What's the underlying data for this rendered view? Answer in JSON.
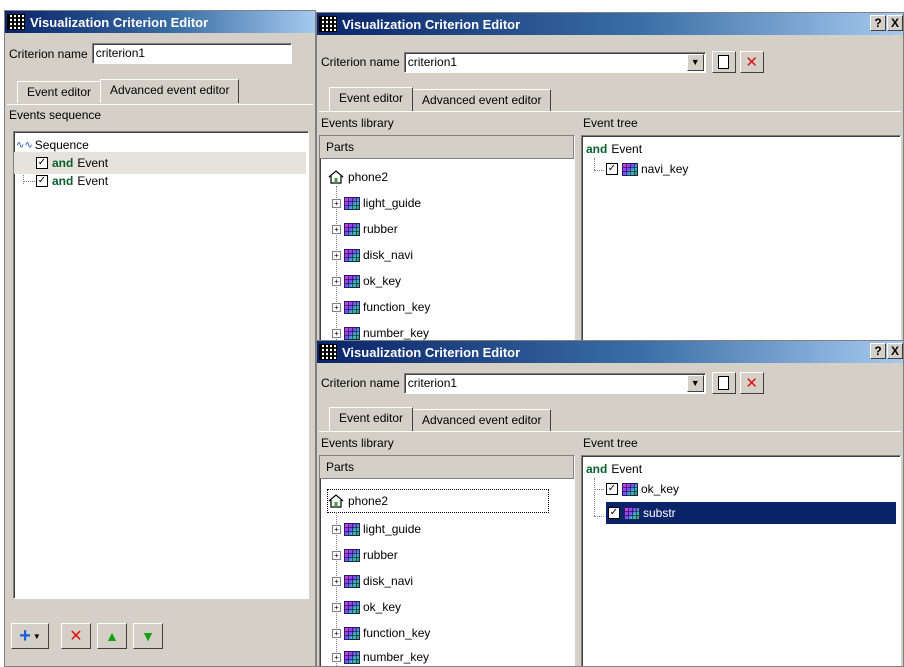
{
  "left_window": {
    "title": "Visualization Criterion Editor",
    "criterion_label": "Criterion name",
    "criterion_value": "criterion1",
    "tabs": [
      {
        "label": "Event editor",
        "active": false
      },
      {
        "label": "Advanced event editor",
        "active": true
      }
    ],
    "section_title": "Events sequence",
    "sequence_label": "Sequence",
    "events": [
      {
        "keyword": "and",
        "label": "Event",
        "checked": true
      },
      {
        "keyword": "and",
        "label": "Event",
        "checked": true
      }
    ],
    "toolbar": {
      "add_icon": "add-dropdown-icon",
      "delete_icon": "delete-icon",
      "up_icon": "move-up-icon",
      "down_icon": "move-down-icon"
    }
  },
  "top_window": {
    "title": "Visualization Criterion Editor",
    "help_label": "?",
    "close_label": "X",
    "criterion_label": "Criterion name",
    "criterion_value": "criterion1",
    "tabs": [
      {
        "label": "Event editor",
        "active": true
      },
      {
        "label": "Advanced event editor",
        "active": false
      }
    ],
    "events_library_label": "Events library",
    "event_tree_label": "Event tree",
    "parts_header": "Parts",
    "root": "phone2",
    "parts": [
      "light_guide",
      "rubber",
      "disk_navi",
      "ok_key",
      "function_key",
      "number_key"
    ],
    "tree_root": {
      "keyword": "and",
      "label": "Event"
    },
    "tree_children": [
      {
        "label": "navi_key",
        "checked": true
      }
    ]
  },
  "bottom_window": {
    "title": "Visualization Criterion Editor",
    "help_label": "?",
    "close_label": "X",
    "criterion_label": "Criterion name",
    "criterion_value": "criterion1",
    "tabs": [
      {
        "label": "Event editor",
        "active": true
      },
      {
        "label": "Advanced event editor",
        "active": false
      }
    ],
    "events_library_label": "Events library",
    "event_tree_label": "Event tree",
    "parts_header": "Parts",
    "root": "phone2",
    "parts": [
      "light_guide",
      "rubber",
      "disk_navi",
      "ok_key",
      "function_key",
      "number_key"
    ],
    "tree_root": {
      "keyword": "and",
      "label": "Event"
    },
    "tree_children": [
      {
        "label": "ok_key",
        "checked": true,
        "selected": false
      },
      {
        "label": "substr",
        "checked": true,
        "selected": true
      }
    ]
  },
  "colors": {
    "title_bar": "#0a246a",
    "and_keyword": "#0b5e2c",
    "selection": "#0a246a",
    "delete_red": "#e01010",
    "arrow_green": "#10a010"
  }
}
